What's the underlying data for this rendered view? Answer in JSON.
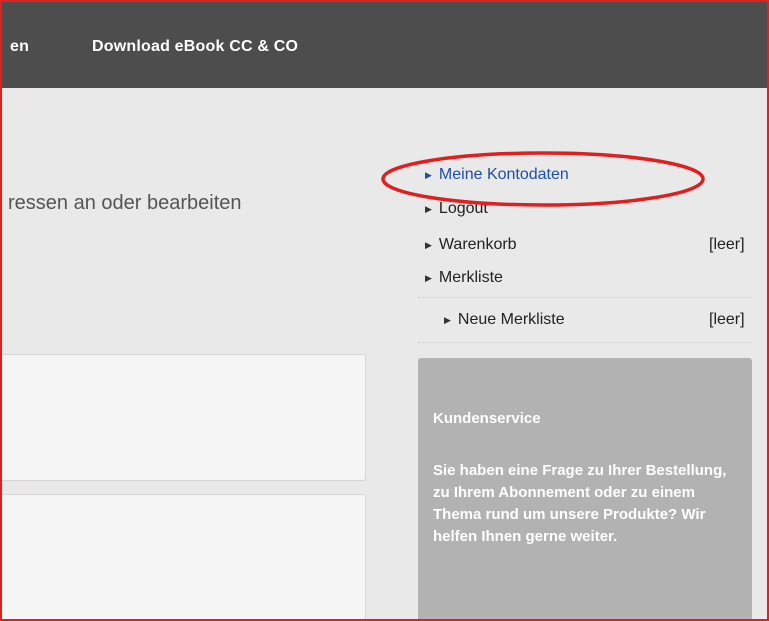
{
  "topnav": {
    "left_fragment": "en",
    "download_label": "Download eBook CC & CO"
  },
  "main": {
    "heading": "ressen an oder bearbeiten"
  },
  "sidebar": {
    "account_label": "Meine Kontodaten",
    "logout_label": "Logout",
    "cart_label": "Warenkorb",
    "cart_count": "[leer]",
    "wishlist_label": "Merkliste",
    "new_wishlist_label": "Neue Merkliste",
    "new_wishlist_count": "[leer]"
  },
  "service": {
    "title": "Kundenservice",
    "text": "Sie haben eine Frage zu Ihrer Bestellung, zu Ihrem Abonnement oder zu einem Thema rund um unsere Produkte? Wir helfen Ihnen gerne weiter."
  },
  "colors": {
    "nav_bg": "#4d4d4d",
    "highlight": "#e01f1f",
    "link_blue": "#1d4fa8",
    "service_bg": "#b2b2b2"
  },
  "icons": {
    "bullet": "triangle-right-icon"
  }
}
